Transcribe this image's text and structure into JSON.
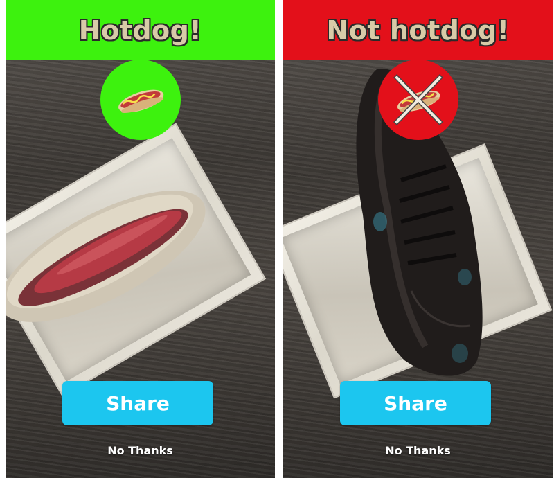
{
  "colors": {
    "positive_banner": "#3df20e",
    "negative_banner": "#e3101a",
    "share_button": "#1cc6ef",
    "title_text": "#d8cba8"
  },
  "left_screen": {
    "result_title": "Hotdog!",
    "badge_icon": "hotdog-icon",
    "share_label": "Share",
    "dismiss_label": "No Thanks"
  },
  "right_screen": {
    "result_title": "Not hotdog!",
    "badge_icon": "hotdog-crossed-icon",
    "share_label": "Share",
    "dismiss_label": "No Thanks"
  }
}
